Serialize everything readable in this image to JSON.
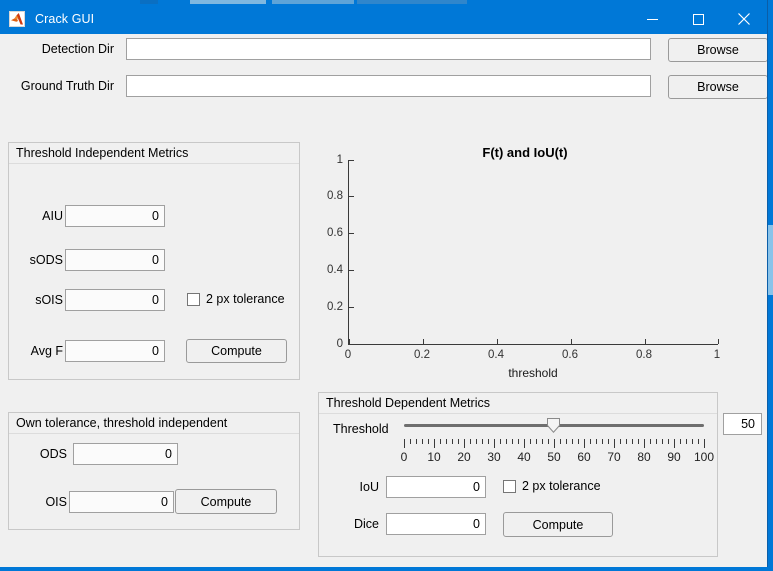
{
  "window": {
    "title": "Crack GUI",
    "icon": "matlab-logo-icon",
    "accent_color": "#0078d7",
    "background_color": "#f0f0f0",
    "minimize_label": "Minimize",
    "maximize_label": "Maximize",
    "close_label": "Close"
  },
  "top_form": {
    "rows": [
      {
        "label": "Detection Dir",
        "value": "",
        "placeholder": "",
        "button": "Browse"
      },
      {
        "label": "Ground Truth Dir",
        "value": "",
        "placeholder": "",
        "button": "Browse"
      }
    ]
  },
  "threshold_independent": {
    "title": "Threshold Independent Metrics",
    "fields": [
      {
        "label": "AIU",
        "value": "0"
      },
      {
        "label": "sODS",
        "value": "0"
      },
      {
        "label": "sOIS",
        "value": "0"
      },
      {
        "label": "Avg F",
        "value": "0"
      }
    ],
    "checkbox": {
      "label": "2 px tolerance",
      "checked": false
    },
    "compute_label": "Compute"
  },
  "own_tolerance": {
    "title": "Own tolerance, threshold independent",
    "fields": [
      {
        "label": "ODS",
        "value": "0"
      },
      {
        "label": "OIS",
        "value": "0"
      }
    ],
    "compute_label": "Compute"
  },
  "threshold_dependent": {
    "title": "Threshold Dependent Metrics",
    "slider": {
      "label": "Threshold",
      "value": 50,
      "min": 0,
      "max": 100,
      "value_display": "50",
      "tick_labels": [
        "0",
        "10",
        "20",
        "30",
        "40",
        "50",
        "60",
        "70",
        "80",
        "90",
        "100"
      ],
      "major_step": 10,
      "minor_step": 2
    },
    "fields": [
      {
        "label": "IoU",
        "value": "0"
      },
      {
        "label": "Dice",
        "value": "0"
      }
    ],
    "checkbox": {
      "label": "2 px tolerance",
      "checked": false
    },
    "compute_label": "Compute"
  },
  "chart_data": {
    "type": "line",
    "title": "F(t) and IoU(t)",
    "xlabel": "threshold",
    "ylabel": "",
    "xlim": [
      0,
      1
    ],
    "ylim": [
      0,
      1
    ],
    "x_ticks": [
      0,
      0.2,
      0.4,
      0.6,
      0.8,
      1
    ],
    "x_tick_labels": [
      "0",
      "0.2",
      "0.4",
      "0.6",
      "0.8",
      "1"
    ],
    "y_ticks": [
      0,
      0.2,
      0.4,
      0.6,
      0.8,
      1
    ],
    "y_tick_labels": [
      "0",
      "0.2",
      "0.4",
      "0.6",
      "0.8",
      "1"
    ],
    "grid": false,
    "legend": null,
    "series": [
      {
        "name": "F(t)",
        "x": [],
        "values": []
      },
      {
        "name": "IoU(t)",
        "x": [],
        "values": []
      }
    ]
  }
}
